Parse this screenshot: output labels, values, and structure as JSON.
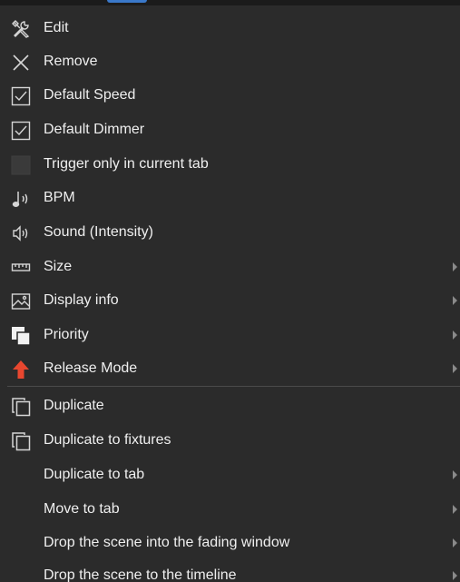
{
  "menu": {
    "items": [
      {
        "id": "edit",
        "label": "Edit",
        "icon": "tools-icon",
        "submenu": false
      },
      {
        "id": "remove",
        "label": "Remove",
        "icon": "close-icon",
        "submenu": false
      },
      {
        "id": "default-speed",
        "label": "Default Speed",
        "icon": "checkbox-checked-icon",
        "checked": true,
        "submenu": false
      },
      {
        "id": "default-dimmer",
        "label": "Default Dimmer",
        "icon": "checkbox-checked-icon",
        "checked": true,
        "submenu": false
      },
      {
        "id": "trigger-only",
        "label": "Trigger only in current tab",
        "icon": "checkbox-unchecked-icon",
        "checked": false,
        "submenu": false
      },
      {
        "id": "bpm",
        "label": "BPM",
        "icon": "music-note-icon",
        "submenu": false
      },
      {
        "id": "sound",
        "label": "Sound (Intensity)",
        "icon": "speaker-icon",
        "submenu": false
      },
      {
        "id": "size",
        "label": "Size",
        "icon": "ruler-icon",
        "submenu": true
      },
      {
        "id": "display-info",
        "label": "Display info",
        "icon": "image-icon",
        "submenu": true
      },
      {
        "id": "priority",
        "label": "Priority",
        "icon": "layers-icon",
        "submenu": true
      },
      {
        "id": "release-mode",
        "label": "Release Mode",
        "icon": "arrow-up-icon",
        "submenu": true
      },
      {
        "id": "duplicate",
        "label": "Duplicate",
        "icon": "duplicate-icon",
        "submenu": false
      },
      {
        "id": "duplicate-fixtures",
        "label": "Duplicate to fixtures",
        "icon": "duplicate-icon",
        "submenu": false
      },
      {
        "id": "duplicate-tab",
        "label": "Duplicate to tab",
        "icon": "",
        "submenu": true
      },
      {
        "id": "move-tab",
        "label": "Move to tab",
        "icon": "",
        "submenu": true
      },
      {
        "id": "drop-fading",
        "label": "Drop the scene into the fading window",
        "icon": "",
        "submenu": true
      },
      {
        "id": "drop-timeline",
        "label": "Drop the scene to the timeline",
        "icon": "",
        "submenu": true
      }
    ]
  },
  "colors": {
    "background": "#2b2b2b",
    "text": "#efefef",
    "icon": "#d6d6d6",
    "release_arrow": "#e8472f",
    "separator": "#4a4a4a",
    "accent": "#3a78c9"
  }
}
